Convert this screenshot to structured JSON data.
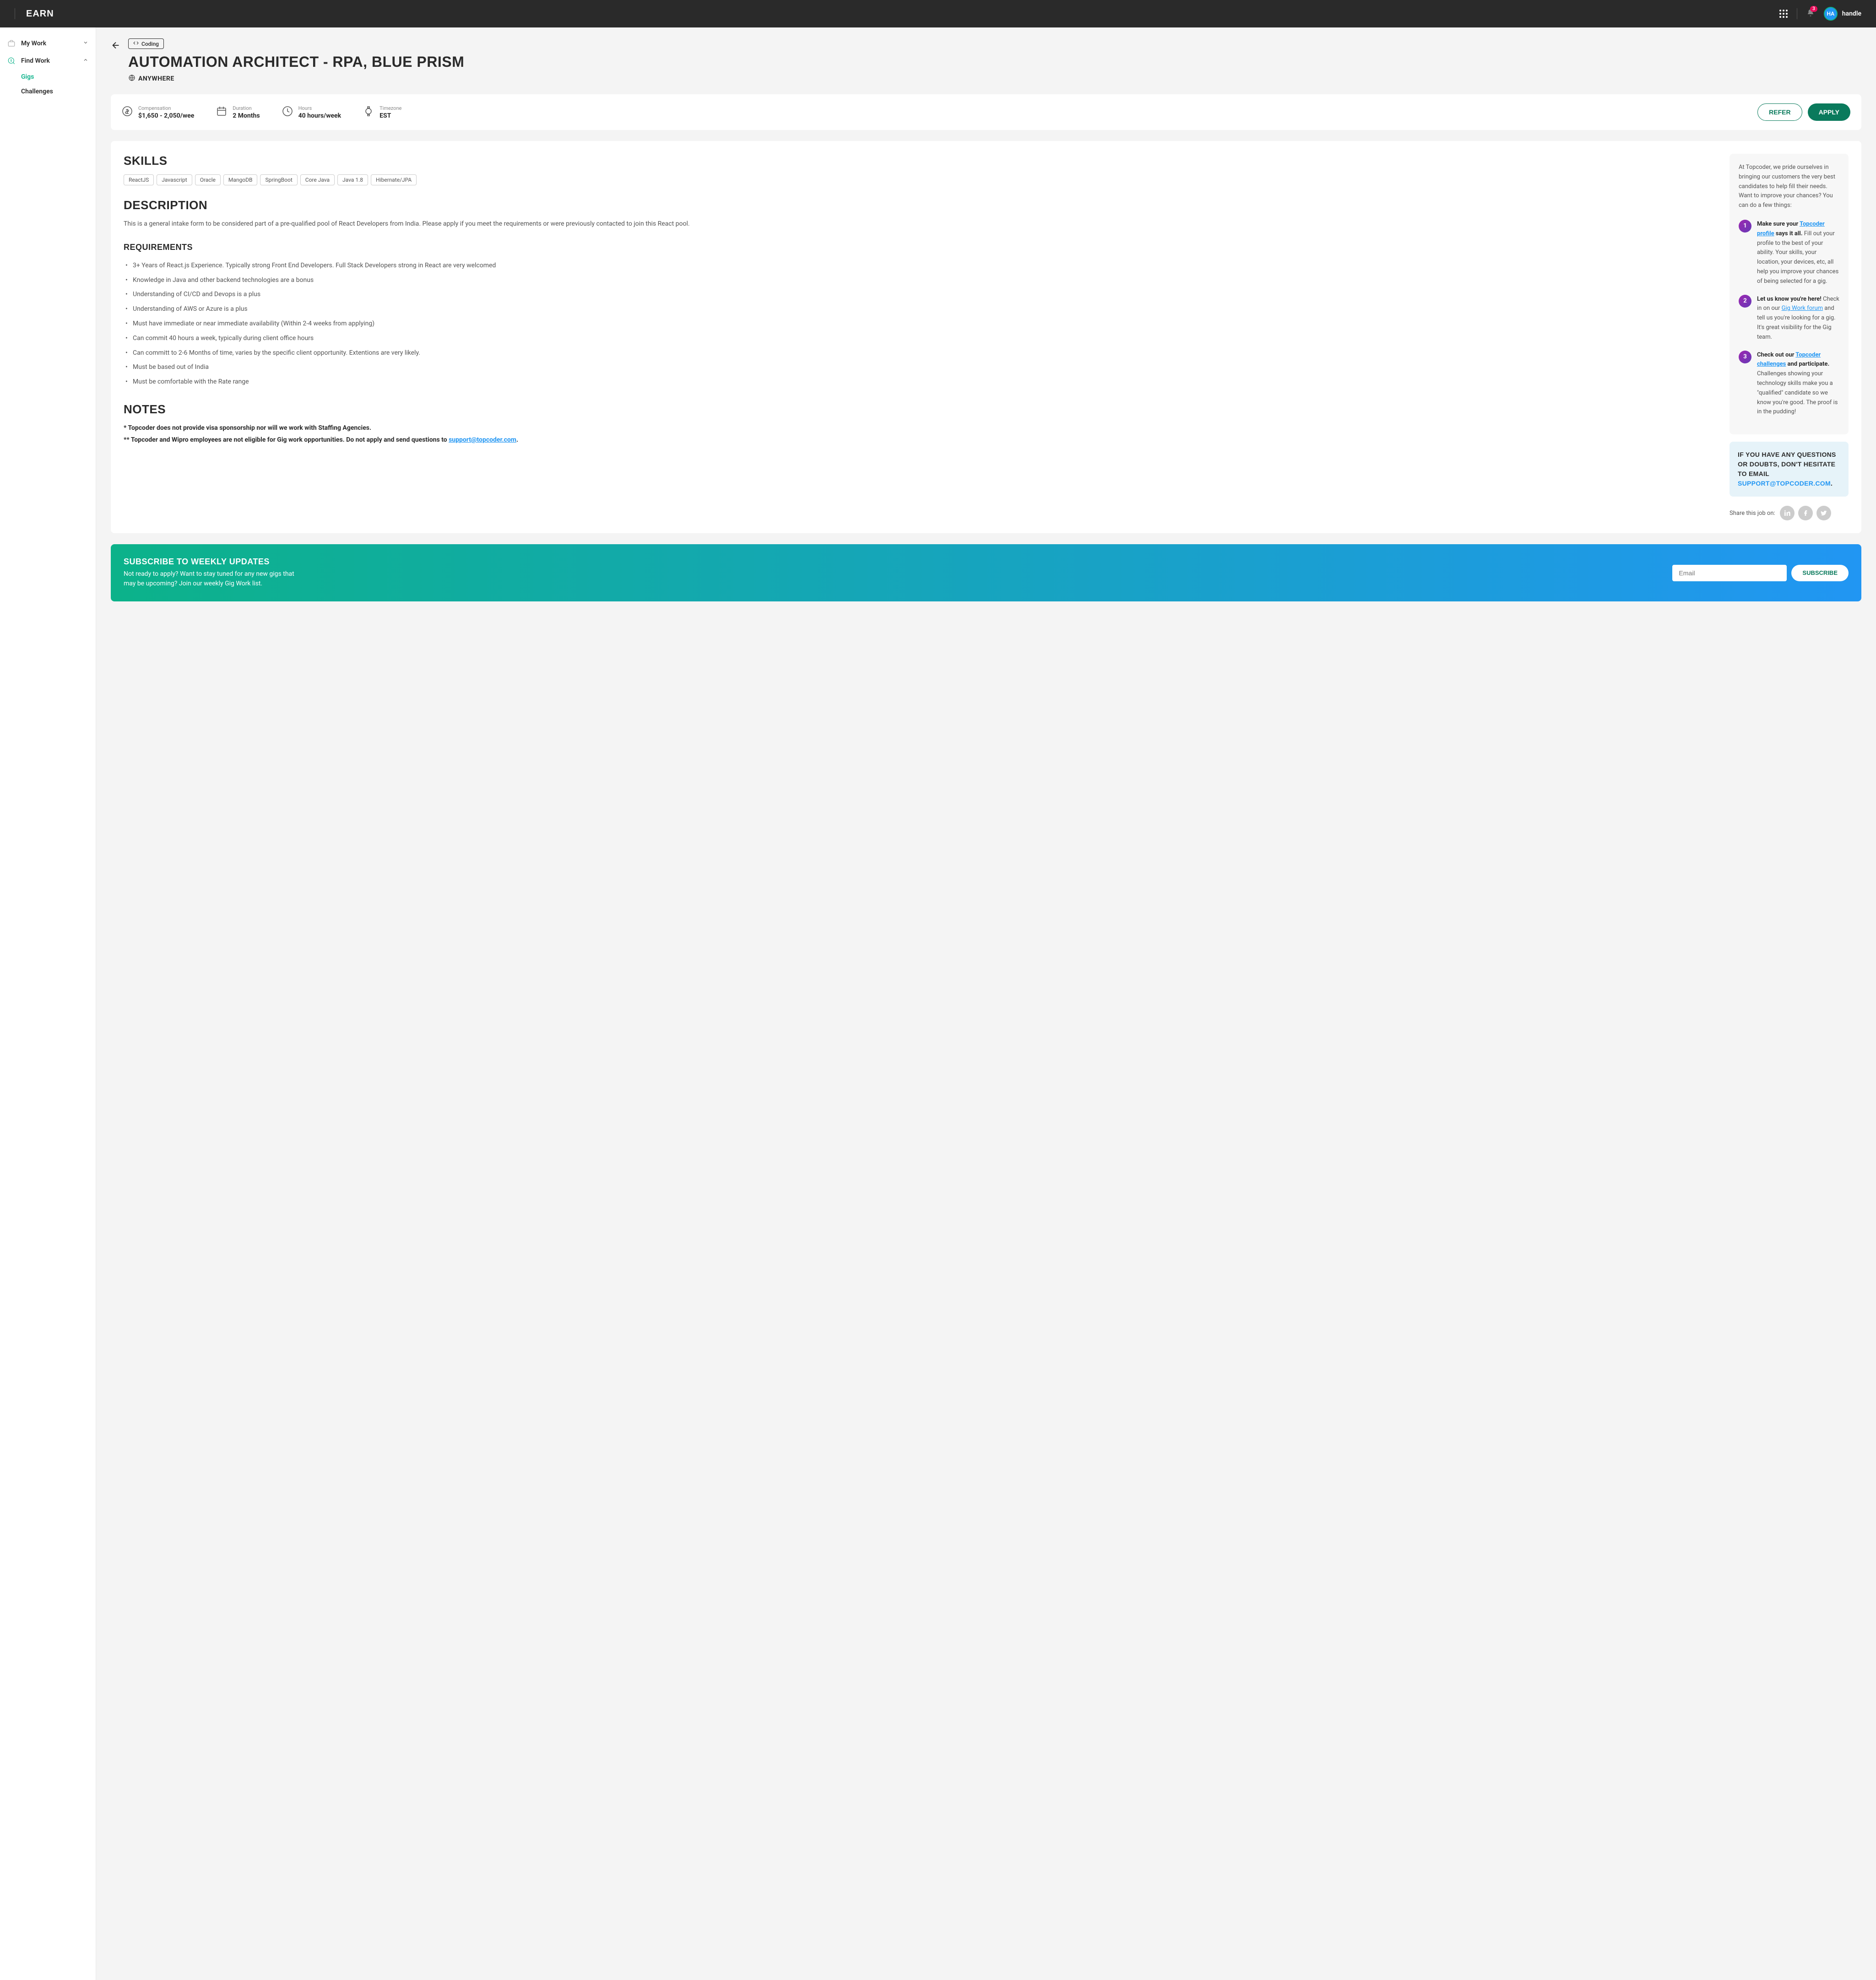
{
  "header": {
    "app_title": "EARN",
    "notification_count": "3",
    "avatar_initials": "HA",
    "handle": "handle"
  },
  "sidebar": {
    "my_work": "My Work",
    "find_work": "Find Work",
    "gigs": "Gigs",
    "challenges": "Challenges"
  },
  "job": {
    "category": "Coding",
    "title": "AUTOMATION ARCHITECT - RPA, BLUE PRISM",
    "location": "ANYWHERE"
  },
  "stats": {
    "compensation_label": "Compensation",
    "compensation_value": "$1,650 - 2,050/wee",
    "duration_label": "Duration",
    "duration_value": "2 Months",
    "hours_label": "Hours",
    "hours_value": "40 hours/week",
    "timezone_label": "Timezone",
    "timezone_value": "EST",
    "refer_btn": "REFER",
    "apply_btn": "APPLY"
  },
  "skills": {
    "title": "SKILLS",
    "tags": [
      "ReactJS",
      "Javascript",
      "Oracle",
      "MangoDB",
      "SpringBoot",
      "Core Java",
      "Java 1.8",
      "Hibernate/JPA"
    ]
  },
  "description": {
    "title": "DESCRIPTION",
    "text": "This is a general intake form to be considered part of a pre-qualified pool of React Developers from India.  Please apply if you meet the requirements or were previously contacted to join this React pool."
  },
  "requirements": {
    "title": "REQUIREMENTS",
    "items": [
      "3+ Years of React.js Experience.  Typically strong Front End Developers.  Full Stack Developers strong in React are very welcomed",
      "Knowledge in Java and other backend technologies are a bonus",
      "Understanding of CI/CD and Devops is a plus",
      "Understanding of AWS or Azure is a plus",
      "Must have immediate or near immediate availability (Within 2-4 weeks from applying)",
      "Can commit 40 hours a week, typically during client office hours",
      "Can committ to 2-6 Months of time, varies by the specific client opportunity. Extentions are very likely.",
      "Must be based out of India",
      "Must be comfortable with the Rate range"
    ]
  },
  "notes": {
    "title": "NOTES",
    "line1": "* Topcoder does not provide visa sponsorship nor will we work with Staffing Agencies.",
    "line2_a": "** Topcoder and Wipro employees are not eligible for Gig work opportunities. Do not apply and send questions to ",
    "line2_link": "support@topcoder.com",
    "line2_b": "."
  },
  "tips": {
    "intro": "At Topcoder, we pride ourselves in bringing our customers the very best candidates to help fill their needs. Want to improve your chances? You can do a few things:",
    "tip1_a": "Make sure your ",
    "tip1_link": "Topcoder profile",
    "tip1_b": " says it all.",
    "tip1_c": " Fill out your profile to the best of your ability. Your skills, your location, your devices, etc, all help you improve your chances of being selected for a gig.",
    "tip2_a": "Let us know you're here!",
    "tip2_b": " Check in on our ",
    "tip2_link": "Gig Work forum",
    "tip2_c": " and tell us you're looking for a gig. It's great visibility for the Gig team.",
    "tip3_a": "Check out our ",
    "tip3_link": "Topcoder challenges",
    "tip3_b": " and participate.",
    "tip3_c": " Challenges showing your technology skills make you a \"qualified\" candidate so we know you're good. The proof is in the pudding!"
  },
  "questions": {
    "text": "IF YOU HAVE ANY QUESTIONS OR DOUBTS, DON'T HESITATE  TO EMAIL ",
    "email": "SUPPORT@TOPCODER.COM",
    "period": "."
  },
  "share": {
    "label": "Share this job on:"
  },
  "subscribe": {
    "title": "SUBSCRIBE TO WEEKLY UPDATES",
    "desc": "Not ready to apply? Want to stay tuned for any new gigs that may be upcoming? Join our weekly Gig Work list.",
    "placeholder": "Email",
    "btn": "SUBSCRIBE"
  }
}
